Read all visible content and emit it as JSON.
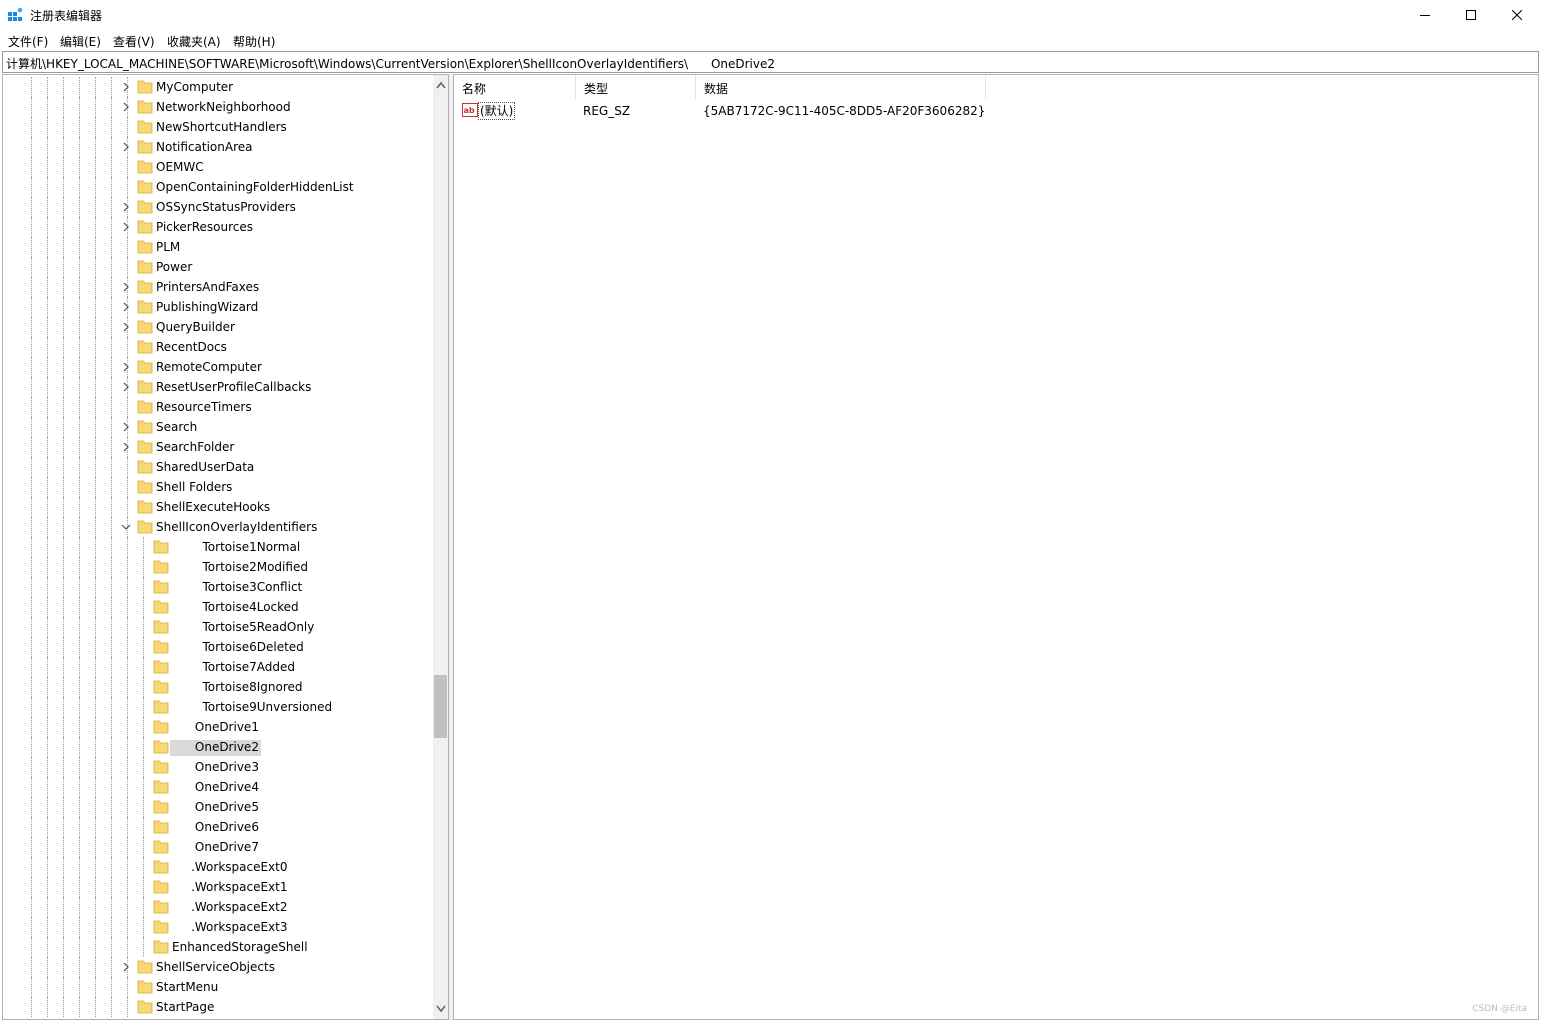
{
  "window": {
    "title": "注册表编辑器",
    "minimize_icon": "minimize-icon",
    "maximize_icon": "maximize-icon",
    "close_icon": "close-icon",
    "app_icon": "registry-editor-icon"
  },
  "menu": {
    "items": [
      "文件(F)",
      "编辑(E)",
      "查看(V)",
      "收藏夹(A)",
      "帮助(H)"
    ]
  },
  "address": {
    "path": "计算机\\HKEY_LOCAL_MACHINE\\SOFTWARE\\Microsoft\\Windows\\CurrentVersion\\Explorer\\ShellIconOverlayIdentifiers\\      OneDrive2"
  },
  "tree": {
    "selected": "OneDrive2",
    "colors": {
      "folder": "#f8d775",
      "folder_edge": "#d7a935",
      "selection": "#d9d9d9"
    },
    "items": [
      {
        "label": "MyComputer",
        "level": 0,
        "expander": "collapsed"
      },
      {
        "label": "NetworkNeighborhood",
        "level": 0,
        "expander": "collapsed"
      },
      {
        "label": "NewShortcutHandlers",
        "level": 0,
        "expander": "none"
      },
      {
        "label": "NotificationArea",
        "level": 0,
        "expander": "collapsed"
      },
      {
        "label": "OEMWC",
        "level": 0,
        "expander": "none"
      },
      {
        "label": "OpenContainingFolderHiddenList",
        "level": 0,
        "expander": "none"
      },
      {
        "label": "OSSyncStatusProviders",
        "level": 0,
        "expander": "collapsed"
      },
      {
        "label": "PickerResources",
        "level": 0,
        "expander": "collapsed"
      },
      {
        "label": "PLM",
        "level": 0,
        "expander": "none"
      },
      {
        "label": "Power",
        "level": 0,
        "expander": "none"
      },
      {
        "label": "PrintersAndFaxes",
        "level": 0,
        "expander": "collapsed"
      },
      {
        "label": "PublishingWizard",
        "level": 0,
        "expander": "collapsed"
      },
      {
        "label": "QueryBuilder",
        "level": 0,
        "expander": "collapsed"
      },
      {
        "label": "RecentDocs",
        "level": 0,
        "expander": "none"
      },
      {
        "label": "RemoteComputer",
        "level": 0,
        "expander": "collapsed"
      },
      {
        "label": "ResetUserProfileCallbacks",
        "level": 0,
        "expander": "collapsed"
      },
      {
        "label": "ResourceTimers",
        "level": 0,
        "expander": "none"
      },
      {
        "label": "Search",
        "level": 0,
        "expander": "collapsed"
      },
      {
        "label": "SearchFolder",
        "level": 0,
        "expander": "collapsed"
      },
      {
        "label": "SharedUserData",
        "level": 0,
        "expander": "none"
      },
      {
        "label": "Shell Folders",
        "level": 0,
        "expander": "none"
      },
      {
        "label": "ShellExecuteHooks",
        "level": 0,
        "expander": "none"
      },
      {
        "label": "ShellIconOverlayIdentifiers",
        "level": 0,
        "expander": "expanded"
      },
      {
        "label": "        Tortoise1Normal",
        "level": 1,
        "expander": "none"
      },
      {
        "label": "        Tortoise2Modified",
        "level": 1,
        "expander": "none"
      },
      {
        "label": "        Tortoise3Conflict",
        "level": 1,
        "expander": "none"
      },
      {
        "label": "        Tortoise4Locked",
        "level": 1,
        "expander": "none"
      },
      {
        "label": "        Tortoise5ReadOnly",
        "level": 1,
        "expander": "none"
      },
      {
        "label": "        Tortoise6Deleted",
        "level": 1,
        "expander": "none"
      },
      {
        "label": "        Tortoise7Added",
        "level": 1,
        "expander": "none"
      },
      {
        "label": "        Tortoise8Ignored",
        "level": 1,
        "expander": "none"
      },
      {
        "label": "        Tortoise9Unversioned",
        "level": 1,
        "expander": "none"
      },
      {
        "label": "      OneDrive1",
        "level": 1,
        "expander": "none"
      },
      {
        "label": "      OneDrive2",
        "level": 1,
        "expander": "none"
      },
      {
        "label": "      OneDrive3",
        "level": 1,
        "expander": "none"
      },
      {
        "label": "      OneDrive4",
        "level": 1,
        "expander": "none"
      },
      {
        "label": "      OneDrive5",
        "level": 1,
        "expander": "none"
      },
      {
        "label": "      OneDrive6",
        "level": 1,
        "expander": "none"
      },
      {
        "label": "      OneDrive7",
        "level": 1,
        "expander": "none"
      },
      {
        "label": "     .WorkspaceExt0",
        "level": 1,
        "expander": "none"
      },
      {
        "label": "     .WorkspaceExt1",
        "level": 1,
        "expander": "none"
      },
      {
        "label": "     .WorkspaceExt2",
        "level": 1,
        "expander": "none"
      },
      {
        "label": "     .WorkspaceExt3",
        "level": 1,
        "expander": "none"
      },
      {
        "label": "EnhancedStorageShell",
        "level": 1,
        "expander": "none"
      },
      {
        "label": "ShellServiceObjects",
        "level": 0,
        "expander": "collapsed"
      },
      {
        "label": "StartMenu",
        "level": 0,
        "expander": "none"
      },
      {
        "label": "StartPage",
        "level": 0,
        "expander": "none"
      }
    ]
  },
  "values": {
    "headers": {
      "name": "名称",
      "type": "类型",
      "data": "数据"
    },
    "rows": [
      {
        "icon": "string-value-icon",
        "name": "(默认)",
        "type": "REG_SZ",
        "data": "{5AB7172C-9C11-405C-8DD5-AF20F3606282}"
      }
    ]
  },
  "watermark": "CSDN @Eita"
}
